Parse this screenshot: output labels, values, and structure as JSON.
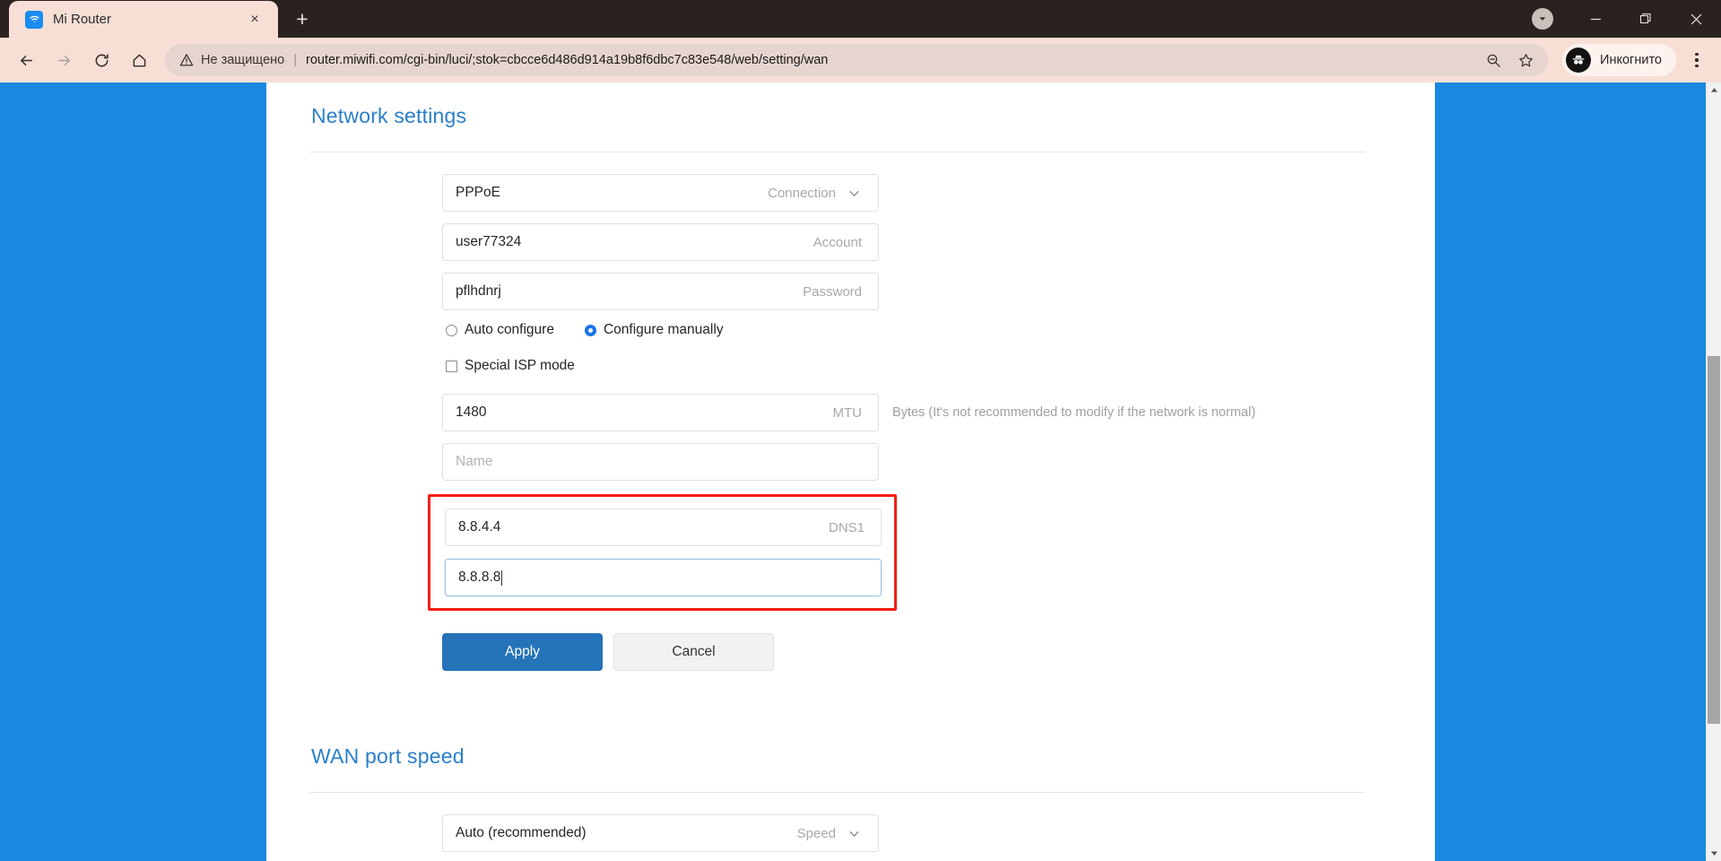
{
  "browser": {
    "tab": {
      "title": "Mi Router",
      "favicon": "wifi-icon",
      "close_label": "×"
    },
    "new_tab_label": "+",
    "window_controls": {
      "tab_search": "tab-search-icon",
      "minimize": "—",
      "maximize": "❐",
      "close": "✕"
    },
    "toolbar": {
      "back": "←",
      "forward": "→",
      "reload": "⟳",
      "home": "⌂",
      "security_warning": "Не защищено",
      "separator": "|",
      "url": "router.miwifi.com/cgi-bin/luci/;stok=cbcce6d486d914a19b8f6dbc7c83e548/web/setting/wan",
      "zoom_out_icon": "zoom-out-icon",
      "bookmark_icon": "star-icon",
      "profile_name": "Инкогнито",
      "profile_avatar": "incognito-icon",
      "menu": "three-dots-icon"
    }
  },
  "page": {
    "network_settings": {
      "title": "Network settings",
      "fields": [
        {
          "name": "connection-type",
          "value": "PPPoE",
          "label": "Connection",
          "placeholder": "",
          "type": "select",
          "focused": false
        },
        {
          "name": "account",
          "value": "user77324",
          "label": "Account",
          "placeholder": "Account",
          "type": "text",
          "focused": false
        },
        {
          "name": "password",
          "value": "pflhdnrj",
          "label": "Password",
          "placeholder": "Password",
          "type": "text",
          "focused": false
        }
      ],
      "config_mode": {
        "auto": {
          "label": "Auto configure",
          "selected": false
        },
        "manual": {
          "label": "Configure manually",
          "selected": true
        }
      },
      "special_isp": {
        "label": "Special ISP mode",
        "checked": false
      },
      "mtu": {
        "value": "1480",
        "label": "MTU",
        "hint": "Bytes (It's not recommended to modify if the network is normal)"
      },
      "service_name": {
        "value": "",
        "placeholder": "Name",
        "label": ""
      },
      "dns": {
        "highlight_color": "#f81c14",
        "dns1": {
          "value": "8.8.4.4",
          "label": "DNS1",
          "focused": false
        },
        "dns2": {
          "value": "8.8.8.8",
          "label": "",
          "focused": true
        }
      },
      "buttons": {
        "apply": "Apply",
        "cancel": "Cancel"
      }
    },
    "wan_port_speed": {
      "title": "WAN port speed",
      "field": {
        "value": "Auto (recommended)",
        "label": "Speed"
      }
    },
    "colors": {
      "accent_blue": "#2a7fc9",
      "page_bg": "#1a88e0",
      "primary_button": "#2573b9"
    }
  }
}
